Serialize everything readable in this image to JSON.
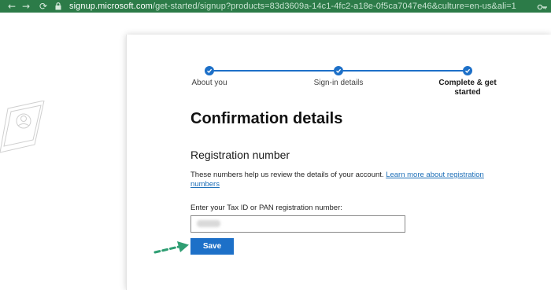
{
  "browser": {
    "url_domain": "signup.microsoft.com",
    "url_path": "/get-started/signup?products=83d3609a-14c1-4fc2-a18e-0f5ca7047e46&culture=en-us&ali=1"
  },
  "steps": [
    {
      "label": "About you",
      "state": "complete"
    },
    {
      "label": "Sign-in details",
      "state": "complete"
    },
    {
      "label": "Complete & get started",
      "state": "active"
    }
  ],
  "page": {
    "title": "Confirmation details",
    "subtitle": "Registration number",
    "description": "These numbers help us review the details of your account.",
    "learn_more_link": "Learn more about registration numbers",
    "field_label": "Enter your Tax ID or PAN registration number:",
    "save_label": "Save"
  },
  "colors": {
    "accent": "#1d70c8",
    "browser_bar": "#2c7b48",
    "arrow": "#2f9e73"
  }
}
